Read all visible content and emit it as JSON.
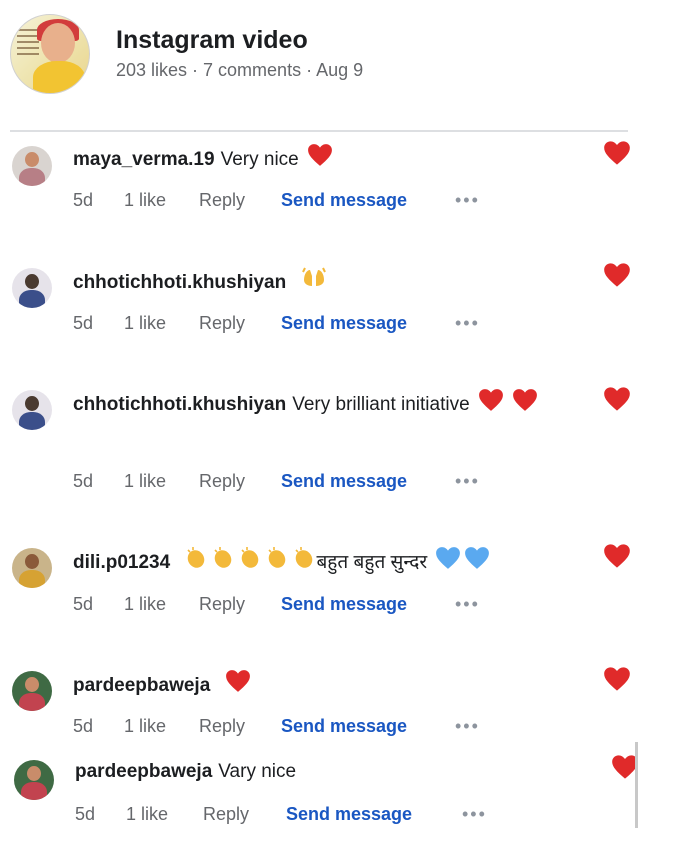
{
  "post": {
    "title": "Instagram video",
    "meta": "203 likes · 7 comments · Aug 9"
  },
  "colors": {
    "heart": "#e02a2a",
    "blue_heart": "#5aa9f0",
    "clap": "#f3b93a",
    "link": "#1a57c2",
    "meta": "#65676b"
  },
  "comments": [
    {
      "user": "maya_verma.19",
      "text": "Very nice",
      "trailing": [
        "red-heart"
      ],
      "time": "5d",
      "likes": "1 like",
      "reply": "Reply",
      "send": "Send message",
      "more": "•••"
    },
    {
      "user": "chhotichhoti.khushiyan",
      "text": "",
      "trailing": [
        "raising-hands"
      ],
      "time": "5d",
      "likes": "1 like",
      "reply": "Reply",
      "send": "Send message",
      "more": "•••"
    },
    {
      "user": "chhotichhoti.khushiyan",
      "text": "Very brilliant initiative",
      "trailing": [
        "red-heart",
        "red-heart"
      ],
      "time": "5d",
      "likes": "1 like",
      "reply": "Reply",
      "send": "Send message",
      "more": "•••"
    },
    {
      "user": "dili.p01234",
      "text": "बहुत बहुत सुन्दर",
      "leading": [
        "clapping-hands",
        "clapping-hands",
        "clapping-hands",
        "clapping-hands",
        "clapping-hands"
      ],
      "trailing": [
        "blue-heart",
        "blue-heart"
      ],
      "time": "5d",
      "likes": "1 like",
      "reply": "Reply",
      "send": "Send message",
      "more": "•••"
    },
    {
      "user": "pardeepbaweja",
      "text": "",
      "trailing": [
        "red-heart"
      ],
      "time": "5d",
      "likes": "1 like",
      "reply": "Reply",
      "send": "Send message",
      "more": "•••"
    },
    {
      "user": "pardeepbaweja",
      "text": "Vary nice",
      "trailing": [],
      "time": "5d",
      "likes": "1 like",
      "reply": "Reply",
      "send": "Send message",
      "more": "•••"
    }
  ]
}
